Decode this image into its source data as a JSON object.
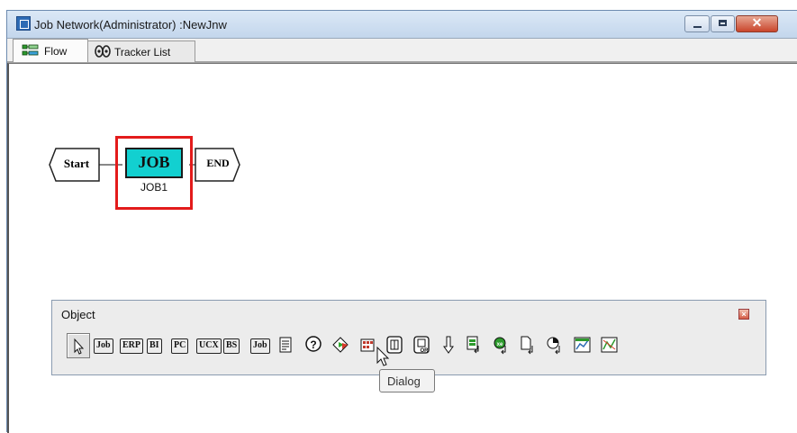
{
  "window": {
    "title": "Job Network(Administrator) :NewJnw",
    "controls": {
      "minimize_icon": "minimize-icon",
      "maximize_icon": "maximize-icon",
      "close_glyph": "✕"
    }
  },
  "tabs": [
    {
      "label": "Flow",
      "icon": "flow-icon",
      "active": true
    },
    {
      "label": "Tracker List",
      "icon": "tracker-icon",
      "active": false
    }
  ],
  "canvas": {
    "start_label": "Start",
    "job_text": "JOB",
    "job_name": "JOB1",
    "end_label": "END",
    "selection_color": "#e31b1b",
    "job_color": "#12d0d0"
  },
  "palette": {
    "title": "Object",
    "close_glyph": "×",
    "tools": [
      {
        "name": "select-tool",
        "kind": "arrow"
      },
      {
        "name": "job-tool",
        "text": "Job"
      },
      {
        "name": "erp-tool",
        "text": "ERP"
      },
      {
        "name": "bi-tool",
        "text": "BI"
      },
      {
        "name": "pc-tool",
        "text": "PC"
      },
      {
        "name": "ucx-tool",
        "text": "UCX"
      },
      {
        "name": "bs-tool",
        "text": "BS"
      },
      {
        "name": "job-variant-tool",
        "text": "Job"
      },
      {
        "name": "script-tool",
        "kind": "doc"
      },
      {
        "name": "dialog-tool",
        "kind": "question"
      },
      {
        "name": "event-tool",
        "kind": "diamond"
      },
      {
        "name": "calendar-tool",
        "kind": "grid"
      },
      {
        "name": "parallel-tool",
        "kind": "parallel"
      },
      {
        "name": "or-tool",
        "kind": "or"
      },
      {
        "name": "wait-tool",
        "kind": "down-arrow"
      },
      {
        "name": "sub-jnw-tool",
        "kind": "page"
      },
      {
        "name": "send-event-tool",
        "kind": "circle-arrow"
      },
      {
        "name": "file-wait-tool",
        "kind": "file-arrow"
      },
      {
        "name": "time-wait-tool",
        "kind": "clock-arrow"
      },
      {
        "name": "chart-tool",
        "kind": "chart1"
      },
      {
        "name": "chart2-tool",
        "kind": "chart2"
      }
    ]
  },
  "tooltip": {
    "text": "Dialog"
  }
}
